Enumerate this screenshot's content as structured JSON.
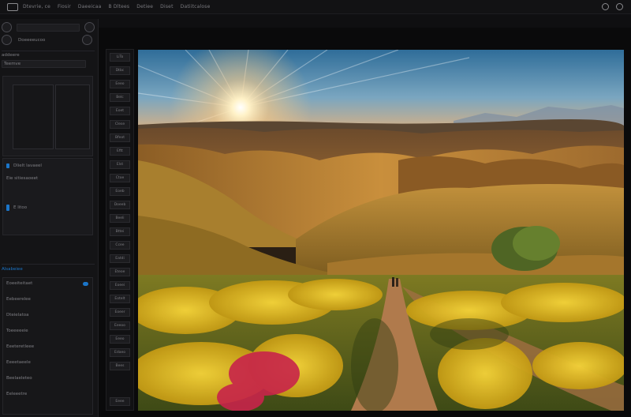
{
  "menubar": {
    "items": [
      "Dtevrie, ce",
      "Fiosir",
      "Daeeicaa",
      "B  Dltees",
      "Detiee",
      "Diset",
      "Datiitcalose"
    ]
  },
  "left_panel": {
    "header_label": "Doeeeeucoo",
    "tab_label": "addeere",
    "tab_status": "Teemve",
    "section_title": "Dlielt lavaeel",
    "section_sub": "Eie sitiesaoeet",
    "layer_label": "E litoo",
    "group_label": "Alsabeiee",
    "list_items": [
      "Eoeeiteitaet",
      "Eebeerelee",
      "Dteielatoa",
      "Toeeeeeie",
      "Eeeteretleee",
      "Eeeetaeele",
      "Beelaeleteo",
      "Eeleeetre"
    ],
    "accent_color": "#1b75c8"
  },
  "filmstrip": {
    "thumbs": [
      "LiTo",
      "Dtbc",
      "Eeeo",
      "Belc",
      "Eoet",
      "Clese",
      "Bfeot",
      "Eftt",
      "Elst",
      "Ctoe",
      "Eoeb",
      "Doeeb",
      "Beeli",
      "Bttei",
      "Ccee",
      "Eatdi",
      "Eteoe",
      "Eoeei",
      "Eotelt",
      "Eoeer",
      "Eeeoo",
      "Eeeo",
      "Edaeo",
      "Bees"
    ],
    "footer_label": "Eeee"
  },
  "image": {
    "description_colors": {
      "sky_top": "#2f6d99",
      "sky_horizon": "#e8b27a",
      "hills": "#b77a2c",
      "flowers": "#e0b21a",
      "path": "#b07a4c"
    }
  }
}
